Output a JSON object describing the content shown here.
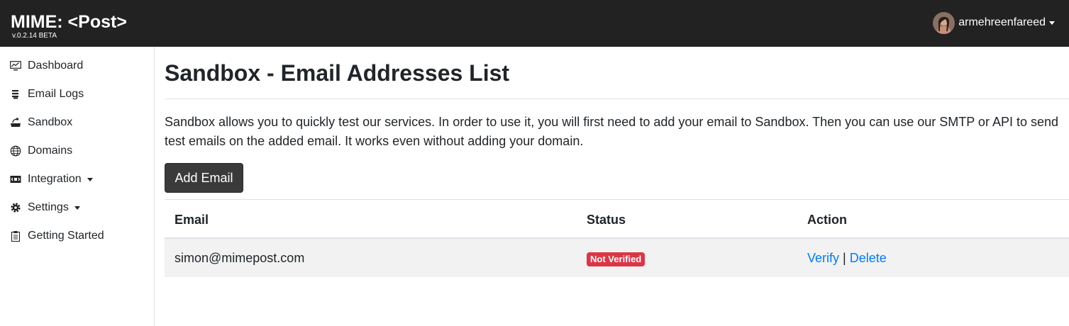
{
  "app": {
    "brand": "MIME: <Post>",
    "version": "v.0.2.14 BETA"
  },
  "user": {
    "name": "armehreenfareed",
    "avatar_icon": "user-avatar"
  },
  "sidebar": {
    "items": [
      {
        "label": "Dashboard",
        "icon": "monitor-chart-icon"
      },
      {
        "label": "Email Logs",
        "icon": "list-log-icon"
      },
      {
        "label": "Sandbox",
        "icon": "sandbox-tray-icon"
      },
      {
        "label": "Domains",
        "icon": "globe-icon"
      },
      {
        "label": "Integration",
        "icon": "integration-icon",
        "dropdown": true
      },
      {
        "label": "Settings",
        "icon": "gear-icon",
        "dropdown": true
      },
      {
        "label": "Getting Started",
        "icon": "clipboard-icon"
      }
    ]
  },
  "main": {
    "title": "Sandbox - Email Addresses List",
    "description": "Sandbox allows you to quickly test our services. In order to use it, you will first need to add your email to Sandbox. Then you can use our SMTP or API to send test emails on the added email. It works even without adding your domain.",
    "add_button": "Add Email",
    "table": {
      "headers": [
        "Email",
        "Status",
        "Action"
      ],
      "rows": [
        {
          "email": "simon@mimepost.com",
          "status": "Not Verified",
          "actions": [
            "Verify",
            "Delete"
          ],
          "separator": "|"
        }
      ]
    }
  },
  "colors": {
    "topbar": "#222222",
    "button": "#3a3a3a",
    "badge_danger": "#dc3545",
    "link": "#007bff",
    "row_stripe": "#f2f2f2"
  }
}
